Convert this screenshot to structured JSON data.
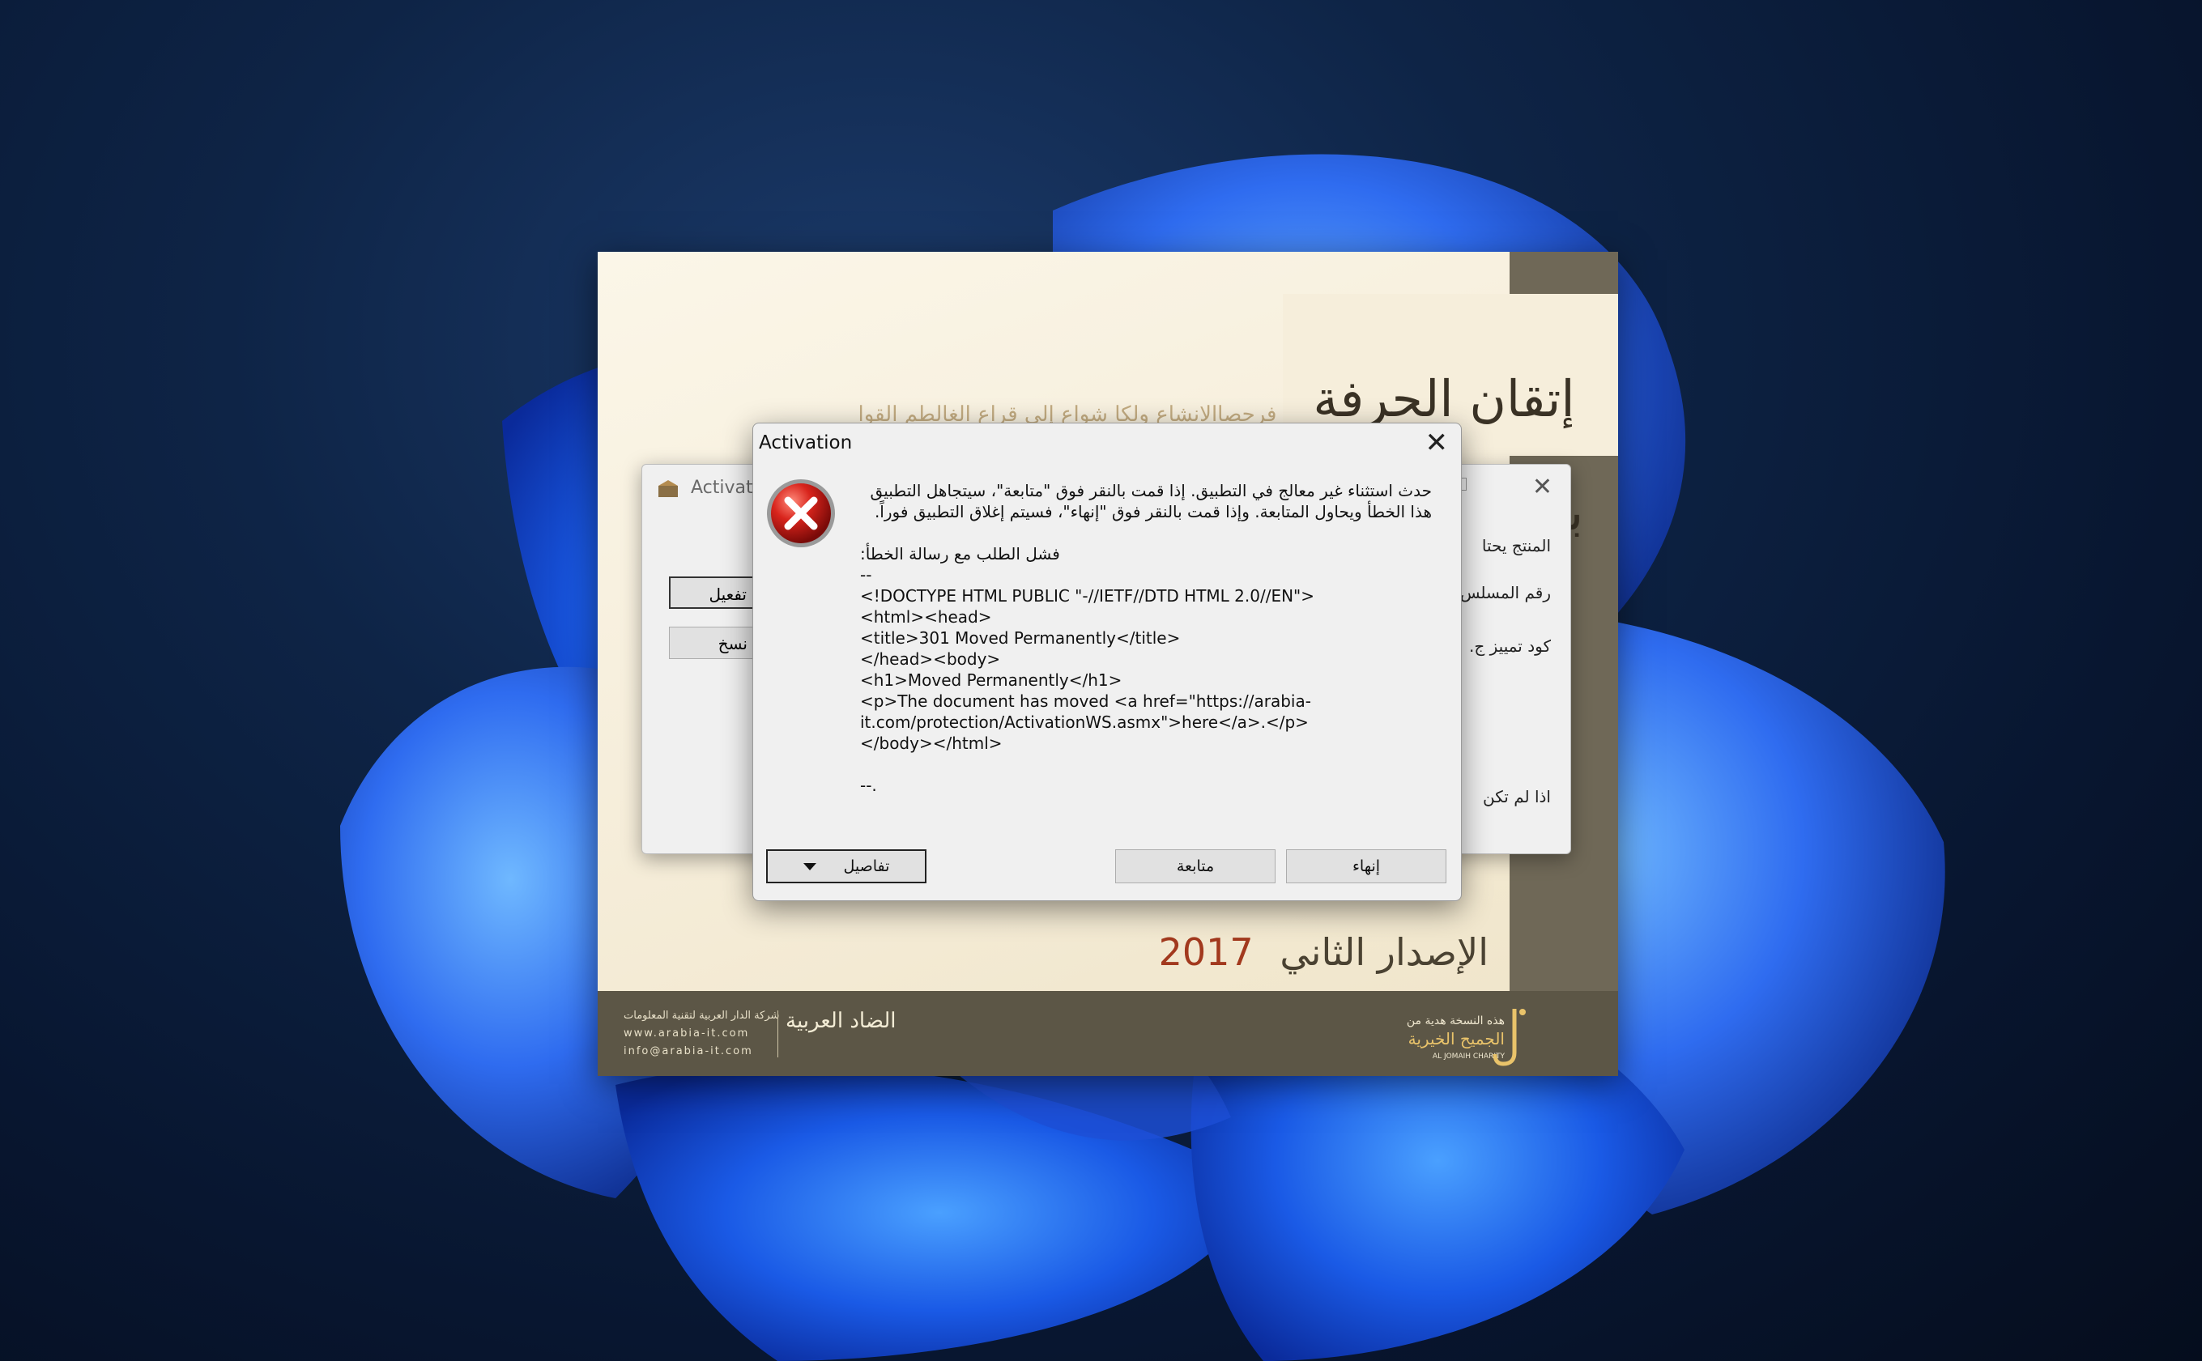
{
  "splash": {
    "calligraphy_title": "إتقان الحرفة بإكمال التحفة",
    "faint_verse": "فرحصاالانشاع ولكا شواع إلى قراع الغالطم القوا",
    "edition_label": "الإصدار الثاني",
    "edition_year": "2017",
    "footer_left_company": "شركة الدار العربية لتقنية المعلومات",
    "footer_left_website": "www.arabia-it.com",
    "footer_left_email": "info@arabia-it.com",
    "footer_left_logo": "الضاد العربية",
    "footer_right_gift": "هذه النسخة هدية من",
    "footer_right_charity": "الجميح الخيرية",
    "footer_right_small": "AL JOMAIH CHARITY"
  },
  "background_window": {
    "title": "Activati",
    "activate_button": "تفعيل",
    "copy_button": "نسخ",
    "lines": [
      "المنتج يحتا",
      "رقم المسلس",
      "كود تمييز ج.",
      "اذا لم تكن"
    ]
  },
  "dialog": {
    "title": "Activation",
    "close_label": "✕",
    "message_arabic": "حدث استثناء غير معالج في التطبيق. إذا قمت بالنقر فوق \"متابعة\"، سيتجاهل التطبيق هذا الخطأ ويحاول المتابعة. وإذا قمت بالنقر فوق \"إنهاء\"، فسيتم إغلاق التطبيق فوراً.",
    "message_failed": "فشل الطلب مع رسالة الخطأ:",
    "message_body": "--\n<!DOCTYPE HTML PUBLIC \"-//IETF//DTD HTML 2.0//EN\">\n<html><head>\n<title>301 Moved Permanently</title>\n</head><body>\n<h1>Moved Permanently</h1>\n<p>The document has moved <a href=\"https://arabia-\nit.com/protection/ActivationWS.asmx\">here</a>.</p>\n</body></html>\n\n--.",
    "details_button": "تفاصيل",
    "continue_button": "متابعة",
    "quit_button": "إنهاء"
  },
  "colors": {
    "dialog_bg": "#f0f0f0",
    "error_red": "#c62020",
    "splash_bg": "#f6eedb",
    "splash_footer": "#5c5646",
    "edition_year": "#a2391e"
  }
}
